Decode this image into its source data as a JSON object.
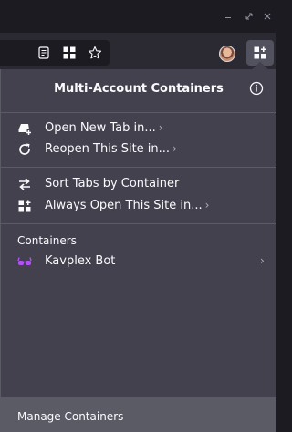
{
  "panel": {
    "title": "Multi-Account Containers",
    "menu_group_1": [
      {
        "label": "Open New Tab in...",
        "chevron": "›"
      },
      {
        "label": "Reopen This Site in...",
        "chevron": "›"
      }
    ],
    "menu_group_2": [
      {
        "label": "Sort Tabs by Container"
      },
      {
        "label": "Always Open This Site in...",
        "chevron": "›"
      }
    ],
    "containers_heading": "Containers",
    "containers": [
      {
        "name": "Kavplex Bot",
        "icon": "glasses-icon",
        "color": "#af51f5",
        "chevron": "›"
      }
    ],
    "footer_label": "Manage Containers"
  },
  "icons": {
    "reader": "reader-view-icon",
    "containers_url": "containers-url-icon",
    "star": "bookmark-star-icon",
    "extension": "containers-extension-icon",
    "info": "info-icon"
  },
  "colors": {
    "panel_bg": "#42414d",
    "footer_bg": "#5b5b66",
    "toolbar_bg": "#2b2a33",
    "titlebar_bg": "#1c1b22",
    "container_accent": "#af51f5"
  }
}
